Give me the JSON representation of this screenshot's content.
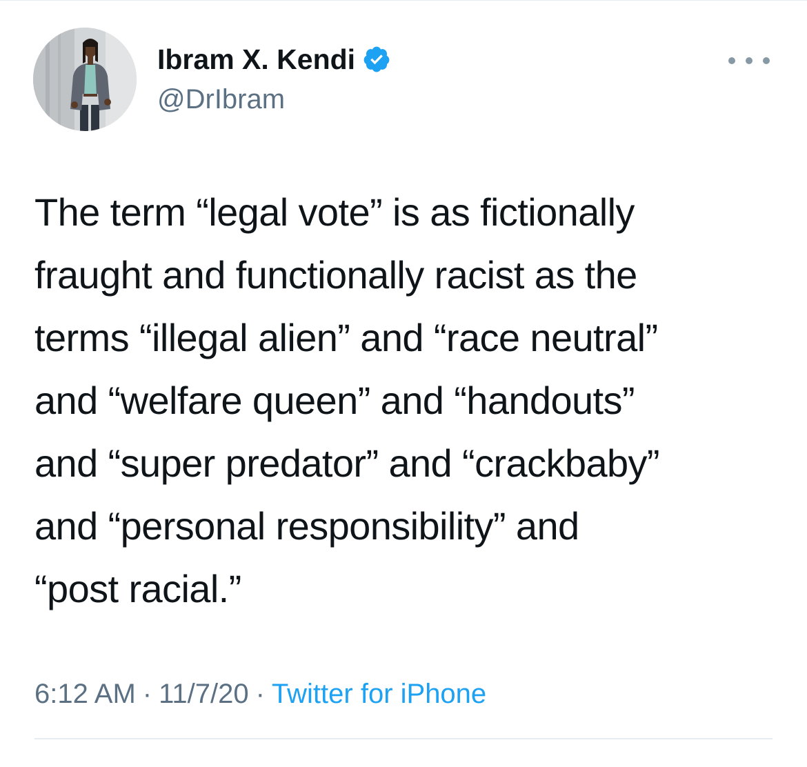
{
  "author": {
    "display_name": "Ibram X. Kendi",
    "handle": "@DrIbram",
    "verified": true,
    "avatar_icon": "profile-photo"
  },
  "menu": {
    "icon": "more-horizontal-icon"
  },
  "tweet": {
    "lines": [
      "The term “legal vote” is as fictionally",
      "fraught and functionally racist as the",
      "terms “illegal alien” and “race neutral”",
      "and “welfare queen” and “handouts”",
      "and “super predator” and “crackbaby”",
      "and “personal responsibility” and",
      "“post racial.”"
    ]
  },
  "meta": {
    "time": "6:12 AM",
    "separator": "·",
    "date": "11/7/20",
    "source": "Twitter for iPhone"
  },
  "colors": {
    "text": "#0f1419",
    "secondary": "#5b7083",
    "link": "#1da1f2",
    "verified_badge": "#1da1f2",
    "divider": "#e6ecf0"
  }
}
